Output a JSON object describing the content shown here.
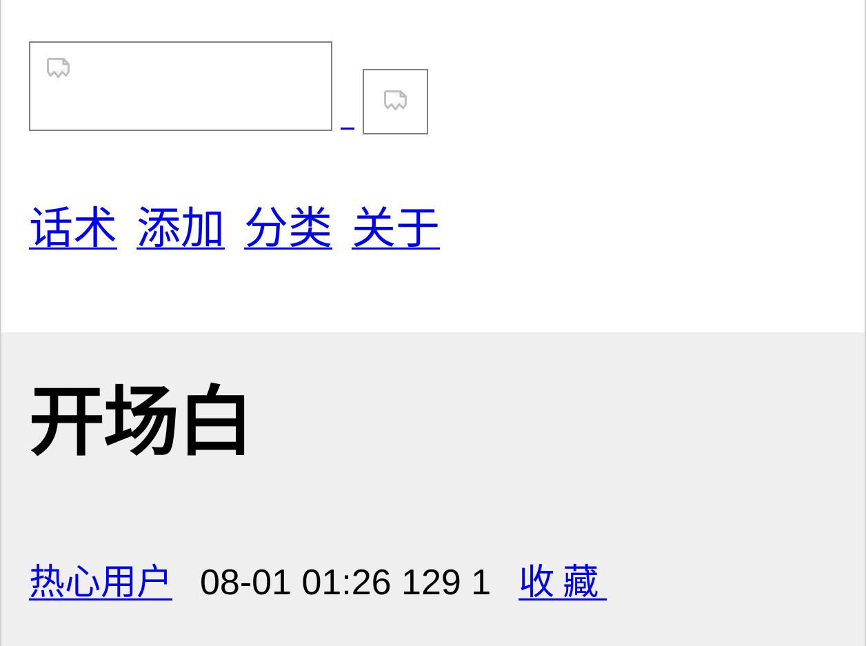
{
  "nav": {
    "items": [
      {
        "label": "话术"
      },
      {
        "label": "添加"
      },
      {
        "label": "分类"
      },
      {
        "label": "关于"
      }
    ]
  },
  "post": {
    "title": "开场白",
    "author": "热心用户",
    "timestamp": "08-01 01:26",
    "views": "129",
    "comments": "1",
    "favorite_label": "收藏"
  }
}
